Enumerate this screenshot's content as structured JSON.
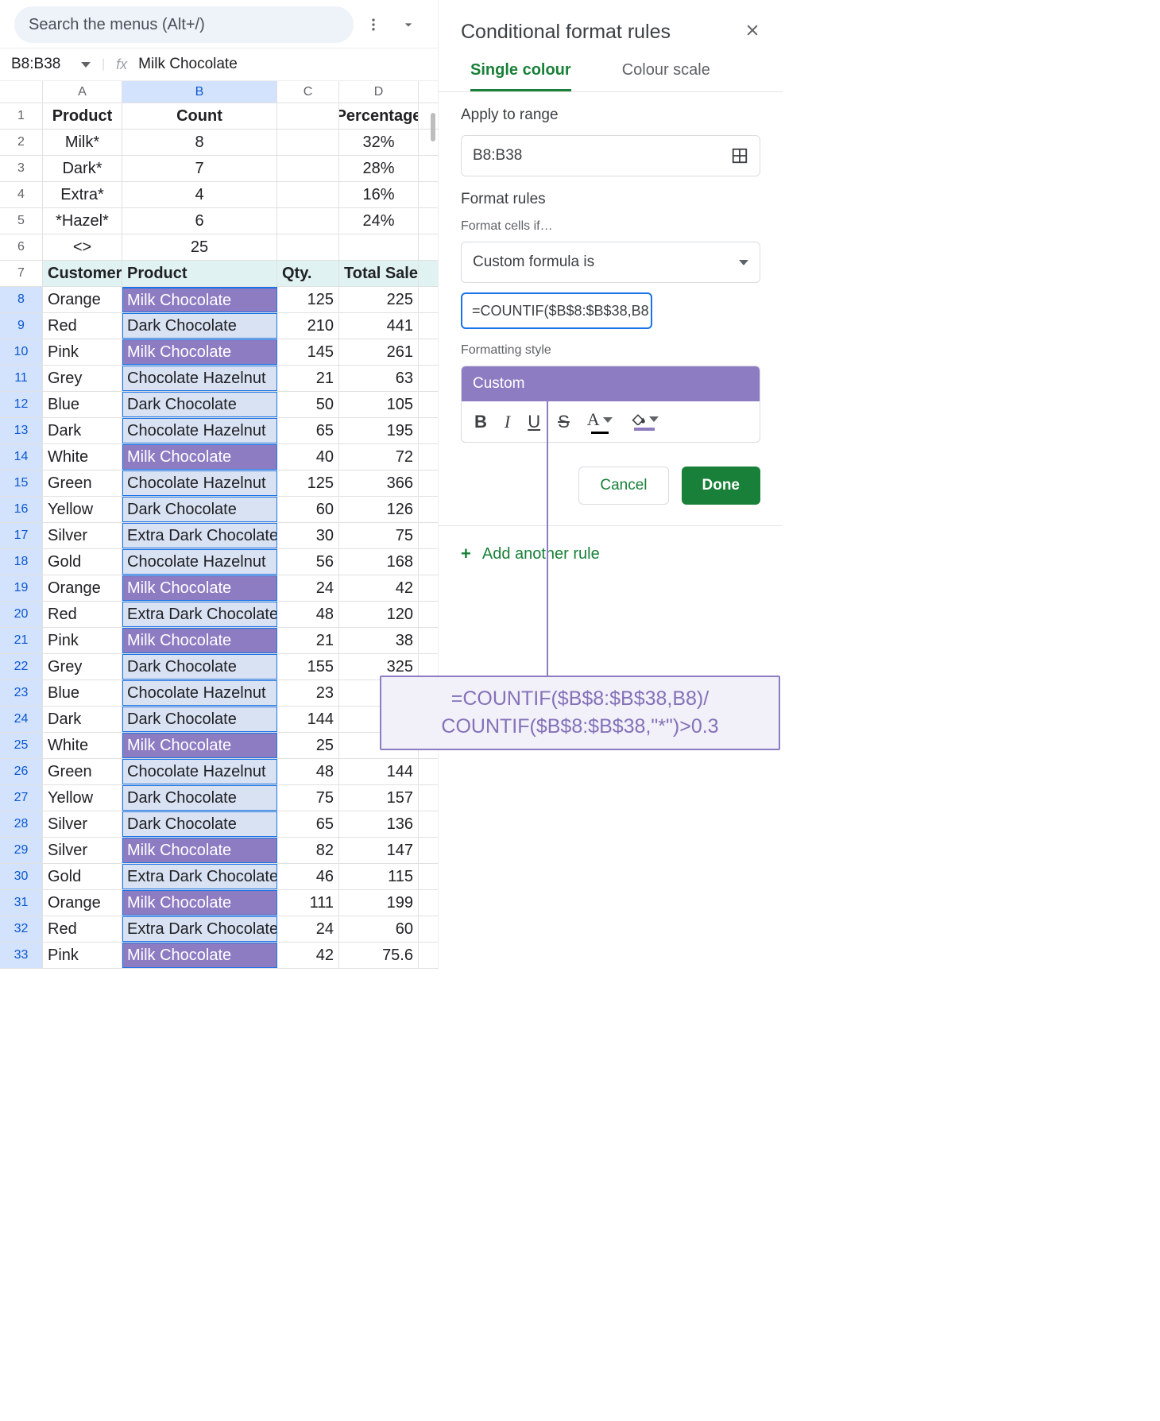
{
  "search_placeholder": "Search the menus (Alt+/)",
  "namebox": "B8:B38",
  "formula_display": "Milk Chocolate",
  "col_headers": [
    "A",
    "B",
    "C",
    "D"
  ],
  "selected_col": "B",
  "row_data": [
    {
      "n": 1,
      "sel": false,
      "a": "Product",
      "b": "Count",
      "c": "",
      "d": "Percentage",
      "bold": true,
      "center": true
    },
    {
      "n": 2,
      "sel": false,
      "a": "Milk*",
      "b": "8",
      "c": "",
      "d": "32%",
      "center": true
    },
    {
      "n": 3,
      "sel": false,
      "a": "Dark*",
      "b": "7",
      "c": "",
      "d": "28%",
      "center": true
    },
    {
      "n": 4,
      "sel": false,
      "a": "Extra*",
      "b": "4",
      "c": "",
      "d": "16%",
      "center": true
    },
    {
      "n": 5,
      "sel": false,
      "a": "*Hazel*",
      "b": "6",
      "c": "",
      "d": "24%",
      "center": true
    },
    {
      "n": 6,
      "sel": false,
      "a": "<>",
      "b": "25",
      "c": "",
      "d": "",
      "center": true
    },
    {
      "n": 7,
      "sel": false,
      "teal": true,
      "a": "Customer",
      "b": "Product",
      "c": "Qty.",
      "d": "Total Sales",
      "bold": true
    },
    {
      "n": 8,
      "sel": true,
      "a": "Orange",
      "b": "Milk Chocolate",
      "bstyle": "dark",
      "c": "125",
      "d": "225",
      "btop": true
    },
    {
      "n": 9,
      "sel": true,
      "a": "Red",
      "b": "Dark Chocolate",
      "bstyle": "light",
      "c": "210",
      "d": "441"
    },
    {
      "n": 10,
      "sel": true,
      "a": "Pink",
      "b": "Milk Chocolate",
      "bstyle": "dark",
      "c": "145",
      "d": "261"
    },
    {
      "n": 11,
      "sel": true,
      "a": "Grey",
      "b": "Chocolate Hazelnut",
      "bstyle": "light",
      "c": "21",
      "d": "63"
    },
    {
      "n": 12,
      "sel": true,
      "a": "Blue",
      "b": "Dark Chocolate",
      "bstyle": "light",
      "c": "50",
      "d": "105"
    },
    {
      "n": 13,
      "sel": true,
      "a": "Dark",
      "b": "Chocolate Hazelnut",
      "bstyle": "light",
      "c": "65",
      "d": "195"
    },
    {
      "n": 14,
      "sel": true,
      "a": "White",
      "b": "Milk Chocolate",
      "bstyle": "dark",
      "c": "40",
      "d": "72"
    },
    {
      "n": 15,
      "sel": true,
      "a": "Green",
      "b": "Chocolate Hazelnut",
      "bstyle": "light",
      "c": "125",
      "d": "366"
    },
    {
      "n": 16,
      "sel": true,
      "a": "Yellow",
      "b": "Dark Chocolate",
      "bstyle": "light",
      "c": "60",
      "d": "126"
    },
    {
      "n": 17,
      "sel": true,
      "a": "Silver",
      "b": "Extra Dark Chocolate",
      "bstyle": "light",
      "c": "30",
      "d": "75"
    },
    {
      "n": 18,
      "sel": true,
      "a": "Gold",
      "b": "Chocolate Hazelnut",
      "bstyle": "light",
      "c": "56",
      "d": "168"
    },
    {
      "n": 19,
      "sel": true,
      "a": "Orange",
      "b": "Milk Chocolate",
      "bstyle": "dark",
      "c": "24",
      "d": "42"
    },
    {
      "n": 20,
      "sel": true,
      "a": "Red",
      "b": "Extra Dark Chocolate",
      "bstyle": "light",
      "c": "48",
      "d": "120"
    },
    {
      "n": 21,
      "sel": true,
      "a": "Pink",
      "b": "Milk Chocolate",
      "bstyle": "dark",
      "c": "21",
      "d": "38"
    },
    {
      "n": 22,
      "sel": true,
      "a": "Grey",
      "b": "Dark Chocolate",
      "bstyle": "light",
      "c": "155",
      "d": "325"
    },
    {
      "n": 23,
      "sel": true,
      "a": "Blue",
      "b": "Chocolate Hazelnut",
      "bstyle": "light",
      "c": "23",
      "d": ""
    },
    {
      "n": 24,
      "sel": true,
      "a": "Dark",
      "b": "Dark Chocolate",
      "bstyle": "light",
      "c": "144",
      "d": ""
    },
    {
      "n": 25,
      "sel": true,
      "a": "White",
      "b": "Milk Chocolate",
      "bstyle": "dark",
      "c": "25",
      "d": ""
    },
    {
      "n": 26,
      "sel": true,
      "a": "Green",
      "b": "Chocolate Hazelnut",
      "bstyle": "light",
      "c": "48",
      "d": "144"
    },
    {
      "n": 27,
      "sel": true,
      "a": "Yellow",
      "b": "Dark Chocolate",
      "bstyle": "light",
      "c": "75",
      "d": "157"
    },
    {
      "n": 28,
      "sel": true,
      "a": "Silver",
      "b": "Dark Chocolate",
      "bstyle": "light",
      "c": "65",
      "d": "136"
    },
    {
      "n": 29,
      "sel": true,
      "a": "Silver",
      "b": "Milk Chocolate",
      "bstyle": "dark",
      "c": "82",
      "d": "147"
    },
    {
      "n": 30,
      "sel": true,
      "a": "Gold",
      "b": "Extra Dark Chocolate",
      "bstyle": "light",
      "c": "46",
      "d": "115"
    },
    {
      "n": 31,
      "sel": true,
      "a": "Orange",
      "b": "Milk Chocolate",
      "bstyle": "dark",
      "c": "111",
      "d": "199"
    },
    {
      "n": 32,
      "sel": true,
      "a": "Red",
      "b": "Extra Dark Chocolate",
      "bstyle": "light",
      "c": "24",
      "d": "60"
    },
    {
      "n": 33,
      "sel": true,
      "a": "Pink",
      "b": "Milk Chocolate",
      "bstyle": "dark",
      "c": "42",
      "d": "75.6"
    }
  ],
  "panel": {
    "title": "Conditional format rules",
    "tab_single": "Single colour",
    "tab_scale": "Colour scale",
    "apply_label": "Apply to range",
    "apply_value": "B8:B38",
    "format_rules": "Format rules",
    "format_if": "Format cells if…",
    "condition": "Custom formula is",
    "formula_value": "=COUNTIF($B$8:$B$38,B8",
    "style_label": "Formatting style",
    "style_name": "Custom",
    "cancel": "Cancel",
    "done": "Done",
    "add_rule": "Add another rule"
  },
  "callout": {
    "line1": "=COUNTIF($B$8:$B$38,B8)/",
    "line2": "COUNTIF($B$8:$B$38,\"*\")>0.3"
  },
  "chart_data": {
    "type": "table",
    "title": "Spreadsheet data",
    "summary_table": {
      "columns": [
        "Product",
        "Count",
        "Percentage"
      ],
      "rows": [
        [
          "Milk*",
          8,
          "32%"
        ],
        [
          "Dark*",
          7,
          "28%"
        ],
        [
          "Extra*",
          4,
          "16%"
        ],
        [
          "*Hazel*",
          6,
          "24%"
        ],
        [
          "<>",
          25,
          ""
        ]
      ]
    },
    "data_table": {
      "columns": [
        "Customer",
        "Product",
        "Qty.",
        "Total Sales"
      ],
      "rows": [
        [
          "Orange",
          "Milk Chocolate",
          125,
          225
        ],
        [
          "Red",
          "Dark Chocolate",
          210,
          441
        ],
        [
          "Pink",
          "Milk Chocolate",
          145,
          261
        ],
        [
          "Grey",
          "Chocolate Hazelnut",
          21,
          63
        ],
        [
          "Blue",
          "Dark Chocolate",
          50,
          105
        ],
        [
          "Dark",
          "Chocolate Hazelnut",
          65,
          195
        ],
        [
          "White",
          "Milk Chocolate",
          40,
          72
        ],
        [
          "Green",
          "Chocolate Hazelnut",
          125,
          366
        ],
        [
          "Yellow",
          "Dark Chocolate",
          60,
          126
        ],
        [
          "Silver",
          "Extra Dark Chocolate",
          30,
          75
        ],
        [
          "Gold",
          "Chocolate Hazelnut",
          56,
          168
        ],
        [
          "Orange",
          "Milk Chocolate",
          24,
          42
        ],
        [
          "Red",
          "Extra Dark Chocolate",
          48,
          120
        ],
        [
          "Pink",
          "Milk Chocolate",
          21,
          38
        ],
        [
          "Grey",
          "Dark Chocolate",
          155,
          325
        ],
        [
          "Blue",
          "Chocolate Hazelnut",
          23,
          null
        ],
        [
          "Dark",
          "Dark Chocolate",
          144,
          null
        ],
        [
          "White",
          "Milk Chocolate",
          25,
          null
        ],
        [
          "Green",
          "Chocolate Hazelnut",
          48,
          144
        ],
        [
          "Yellow",
          "Dark Chocolate",
          75,
          157
        ],
        [
          "Silver",
          "Dark Chocolate",
          65,
          136
        ],
        [
          "Silver",
          "Milk Chocolate",
          82,
          147
        ],
        [
          "Gold",
          "Extra Dark Chocolate",
          46,
          115
        ],
        [
          "Orange",
          "Milk Chocolate",
          111,
          199
        ],
        [
          "Red",
          "Extra Dark Chocolate",
          24,
          60
        ],
        [
          "Pink",
          "Milk Chocolate",
          42,
          75.6
        ]
      ]
    }
  }
}
